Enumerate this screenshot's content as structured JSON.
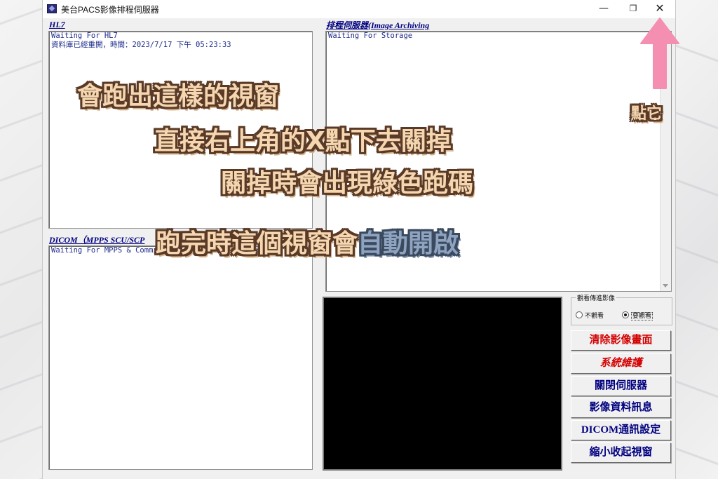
{
  "window": {
    "title": "美台PACS影像排程伺服器",
    "controls": {
      "minimize": "—",
      "maximize": "❐",
      "close": "✕"
    }
  },
  "hl7": {
    "label": "HL7",
    "log": [
      "Waiting For HL7",
      "資料庫已經重開，時間：2023/7/17 下午 05:23:33"
    ]
  },
  "archiving": {
    "label": "排程伺服器(Image Archiving",
    "log": [
      "Waiting For Storage"
    ]
  },
  "dicom": {
    "label": "DICOM（MPPS SCU/SCP",
    "log": [
      "Waiting For MPPS & Commitment another association"
    ]
  },
  "view_group": {
    "title": "觀看傳進影像",
    "options": [
      {
        "label": "不觀看",
        "selected": false
      },
      {
        "label": "要觀看",
        "selected": true
      }
    ]
  },
  "buttons": [
    {
      "label": "清除影像畫面",
      "color": "#d40000",
      "style": "normal"
    },
    {
      "label": "系統維護",
      "color": "#d40000",
      "style": "italic"
    },
    {
      "label": "關閉伺服器",
      "color": "#000080",
      "style": "normal"
    },
    {
      "label": "影像資料訊息",
      "color": "#000080",
      "style": "normal"
    },
    {
      "label": "DICOM通訊設定",
      "color": "#000080",
      "style": "normal"
    },
    {
      "label": "縮小收起視窗",
      "color": "#000080",
      "style": "normal"
    }
  ],
  "overlay": {
    "line1": "會跑出這樣的視窗",
    "line2": "直接右上角的X點下去關掉",
    "line3": "關掉時會出現綠色跑碼",
    "line4_part1": "跑完時這個視窗會",
    "line4_part2": "自動開啟",
    "click_hint": "點它",
    "arrow_color": "#f48fb1"
  }
}
